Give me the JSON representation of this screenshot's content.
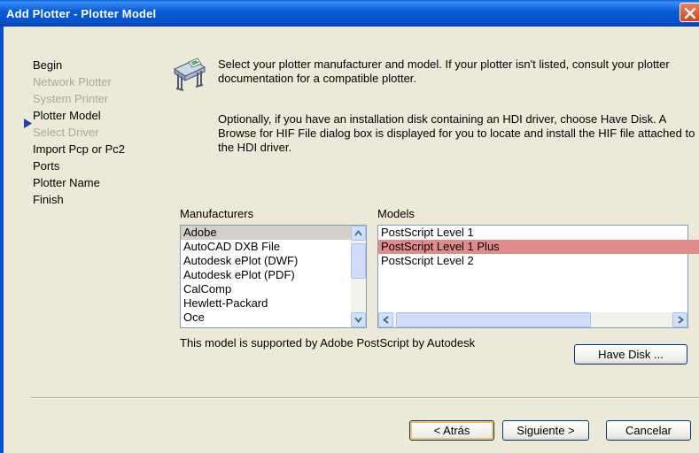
{
  "window": {
    "title": "Add Plotter - Plotter Model"
  },
  "steps": [
    {
      "label": "Begin",
      "state": "normal"
    },
    {
      "label": "Network Plotter",
      "state": "disabled"
    },
    {
      "label": "System Printer",
      "state": "disabled"
    },
    {
      "label": "Plotter Model",
      "state": "current"
    },
    {
      "label": "Select Driver",
      "state": "disabled"
    },
    {
      "label": "Import Pcp or Pc2",
      "state": "normal"
    },
    {
      "label": "Ports",
      "state": "normal"
    },
    {
      "label": "Plotter Name",
      "state": "normal"
    },
    {
      "label": "Finish",
      "state": "normal"
    }
  ],
  "description": {
    "para1": "Select your plotter manufacturer and model. If your plotter isn't listed, consult your plotter documentation for a compatible plotter.",
    "para2": "Optionally, if you have an installation disk containing an HDI driver, choose Have Disk. A Browse for HIF File dialog box is displayed for you to locate and install the HIF file attached to the HDI driver."
  },
  "manufacturers": {
    "label": "Manufacturers",
    "selected": "Adobe",
    "items": [
      "Adobe",
      "AutoCAD DXB File",
      "Autodesk ePlot (DWF)",
      "Autodesk ePlot (PDF)",
      "CalComp",
      "Hewlett-Packard",
      "Oce"
    ]
  },
  "models": {
    "label": "Models",
    "selected": "PostScript Level 1 Plus",
    "items": [
      "PostScript Level 1",
      "PostScript Level 1 Plus",
      "PostScript Level 2"
    ]
  },
  "status_text": "This model is supported by Adobe PostScript by Autodesk",
  "buttons": {
    "have_disk": "Have Disk ...",
    "back": "< Atrás",
    "next": "Siguiente >",
    "cancel": "Cancelar"
  },
  "colors": {
    "titlebar": "#0a5fd8",
    "selected_model_bg": "#e18b8b",
    "selected_manufacturer_bg": "#d4d0c8",
    "disabled_text": "#aca899",
    "dialog_bg": "#ece9d8"
  },
  "icons": {
    "wizard": "plotter-icon",
    "current_step": "triangle-right-icon"
  }
}
